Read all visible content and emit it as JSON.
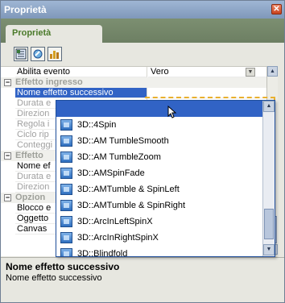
{
  "window": {
    "title": "Proprietà",
    "close_icon": "close-icon"
  },
  "tab": {
    "label": "Proprietà"
  },
  "toolbar": {
    "buttons": [
      {
        "icon": "categorized-icon"
      },
      {
        "icon": "events-icon"
      },
      {
        "icon": "alphabetical-icon"
      }
    ]
  },
  "grid": {
    "rows": [
      {
        "type": "prop",
        "name": "Abilita evento",
        "value": "Vero"
      },
      {
        "type": "cat",
        "name": "Effetto ingresso",
        "expander": "−"
      },
      {
        "type": "prop",
        "name": "Nome effetto successivo",
        "value": ""
      },
      {
        "type": "prop",
        "name": "Durata e",
        "value": ""
      },
      {
        "type": "prop",
        "name": "Direzion",
        "value": ""
      },
      {
        "type": "prop",
        "name": "Regola i",
        "value": ""
      },
      {
        "type": "prop",
        "name": "Ciclo rip",
        "value": ""
      },
      {
        "type": "prop",
        "name": "Conteggi",
        "value": ""
      },
      {
        "type": "cat",
        "name": "Effetto",
        "expander": "−"
      },
      {
        "type": "prop",
        "name": "Nome ef",
        "value": ""
      },
      {
        "type": "prop",
        "name": "Durata e",
        "value": ""
      },
      {
        "type": "prop",
        "name": "Direzion",
        "value": ""
      },
      {
        "type": "cat",
        "name": "Opzion",
        "expander": "−"
      },
      {
        "type": "prop",
        "name": "Blocco e",
        "value": ""
      },
      {
        "type": "prop",
        "name": "Oggetto",
        "value": ""
      },
      {
        "type": "prop",
        "name": "Canvas",
        "value": ""
      }
    ]
  },
  "dropdown": {
    "items": [
      {
        "label": "",
        "selected": true
      },
      {
        "label": "3D::4Spin"
      },
      {
        "label": "3D::AM TumbleSmooth"
      },
      {
        "label": "3D::AM TumbleZoom"
      },
      {
        "label": "3D::AMSpinFade"
      },
      {
        "label": "3D::AMTumble & SpinLeft"
      },
      {
        "label": "3D::AMTumble & SpinRight"
      },
      {
        "label": "3D::ArcInLeftSpinX"
      },
      {
        "label": "3D::ArcInRightSpinX"
      },
      {
        "label": "3D::Blindfold"
      }
    ]
  },
  "description": {
    "title": "Nome effetto successivo",
    "text": "Nome effetto successivo"
  },
  "colors": {
    "selection": "#3163c5",
    "title_bar": "#8aa3c4",
    "tab_strip": "#748766",
    "tab_label": "#4a7a2a",
    "focus_dash": "#e8b030"
  }
}
